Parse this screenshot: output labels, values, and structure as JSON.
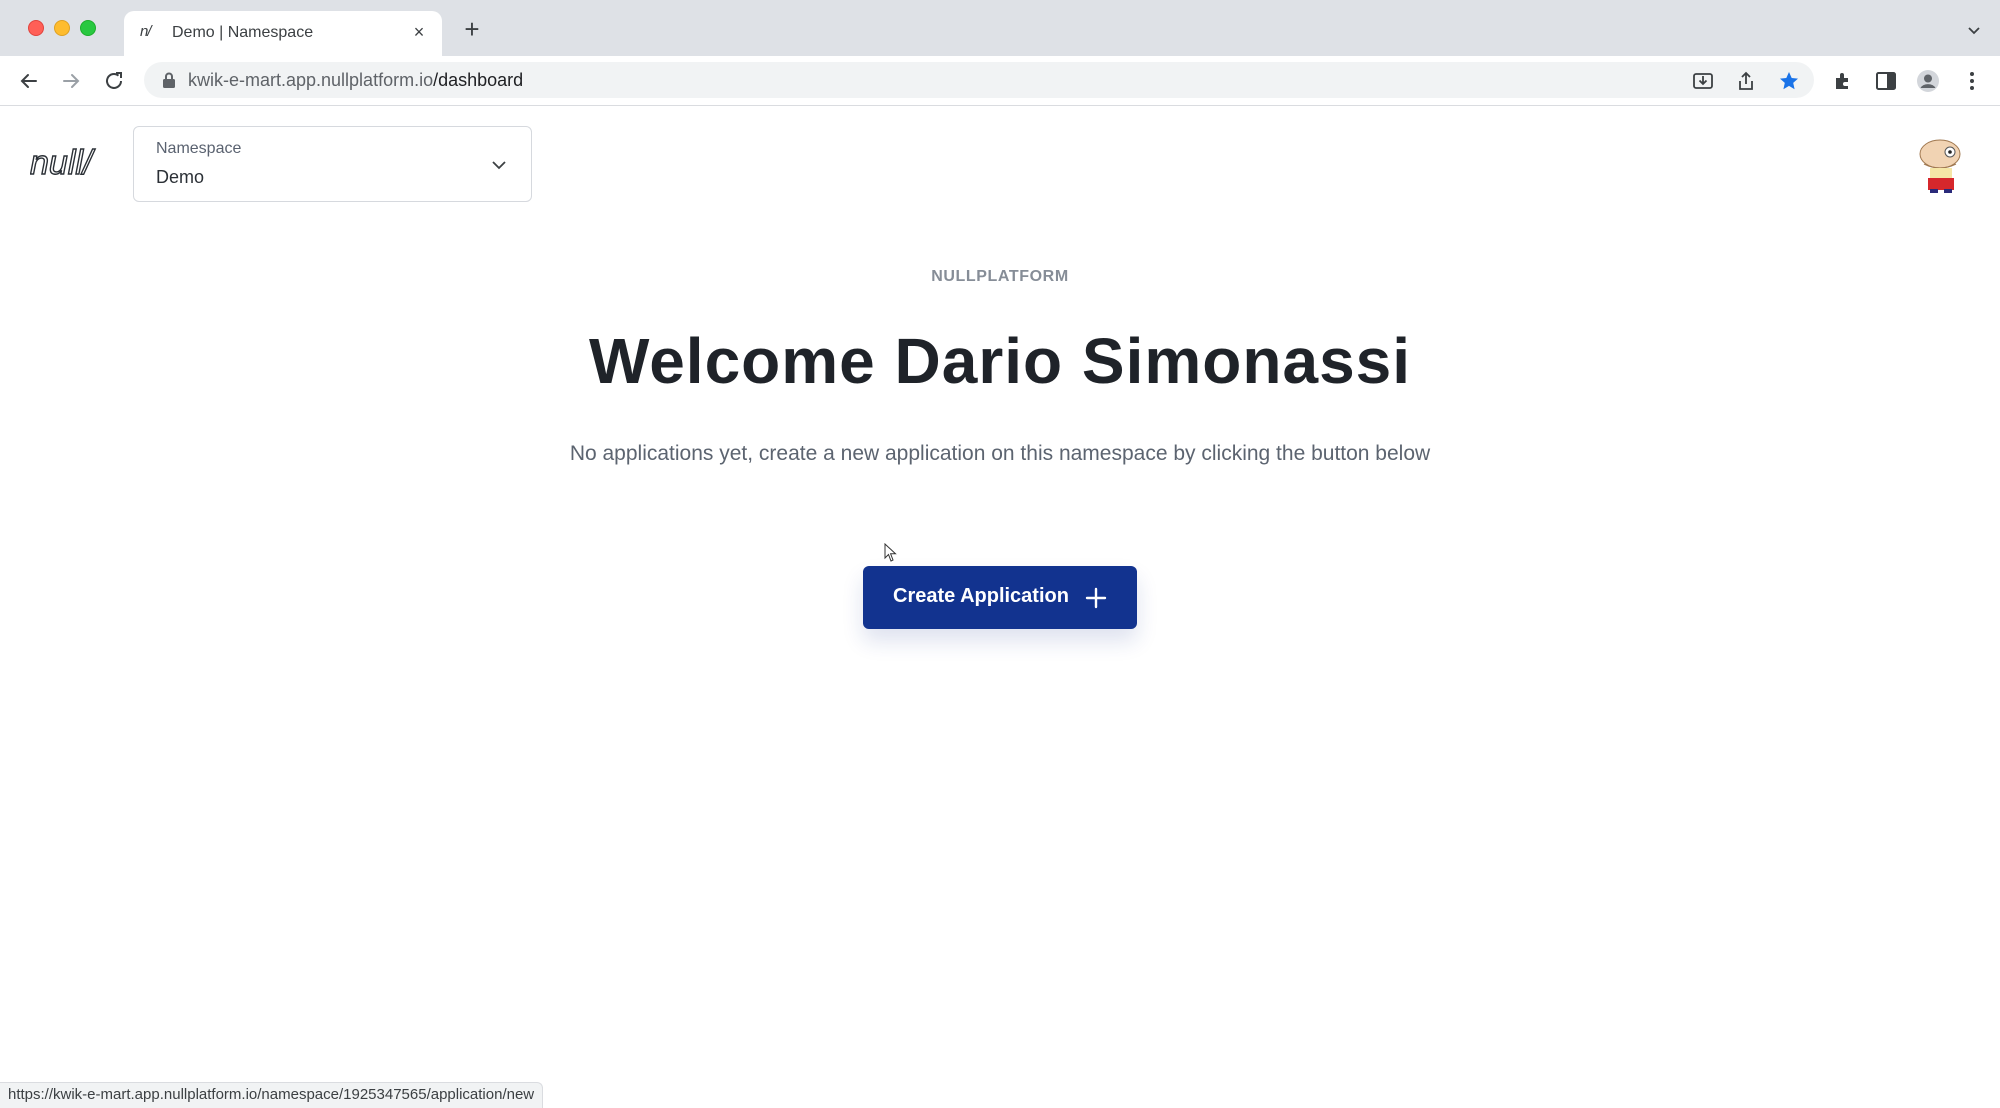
{
  "browser": {
    "tab_title": "Demo | Namespace",
    "tab_favicon": "n/",
    "url_domain": "kwik-e-mart.app.nullplatform.io",
    "url_path": "/dashboard",
    "status_url": "https://kwik-e-mart.app.nullplatform.io/namespace/1925347565/application/new",
    "icons": [
      "back-icon",
      "forward-icon",
      "reload-icon",
      "lock-icon",
      "install-icon",
      "share-icon",
      "bookmark-star-icon",
      "extensions-icon",
      "side-panel-icon",
      "profile-icon",
      "menu-icon"
    ],
    "accent_color": "#1a73e8"
  },
  "header": {
    "logo_text": "null/",
    "namespace": {
      "label": "Namespace",
      "value": "Demo"
    }
  },
  "main": {
    "eyebrow": "NULLPLATFORM",
    "title": "Welcome Dario Simonassi",
    "description": "No applications yet, create a new application on this namespace by clicking the button below",
    "create_button": {
      "label": "Create Application",
      "color": "#12338f"
    }
  }
}
